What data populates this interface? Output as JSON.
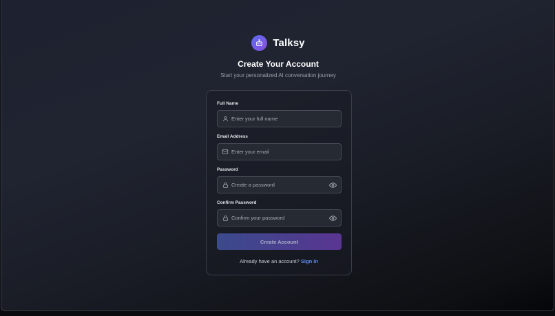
{
  "brand": {
    "name": "Talksy",
    "logo_icon": "robot-icon"
  },
  "heading": {
    "title": "Create Your Account",
    "subtitle": "Start your personalized AI conversation journey"
  },
  "form": {
    "full_name": {
      "label": "Full Name",
      "placeholder": "Enter your full name",
      "value": "",
      "icon": "user-icon"
    },
    "email": {
      "label": "Email Address",
      "placeholder": "Enter your email",
      "value": "",
      "icon": "mail-icon"
    },
    "password": {
      "label": "Password",
      "placeholder": "Create a password",
      "value": "",
      "icon": "lock-icon"
    },
    "confirm_password": {
      "label": "Confirm Password",
      "placeholder": "Confirm your password",
      "value": "",
      "icon": "lock-icon"
    },
    "submit_label": "Create Account",
    "signin_prompt": "Already have an account?",
    "signin_link": "Sign in"
  },
  "colors": {
    "accent_start": "#3b4a8c",
    "accent_end": "#5a3592",
    "link": "#5d8bf0",
    "logo_start": "#5b6cf0",
    "logo_end": "#8a4fe0"
  }
}
